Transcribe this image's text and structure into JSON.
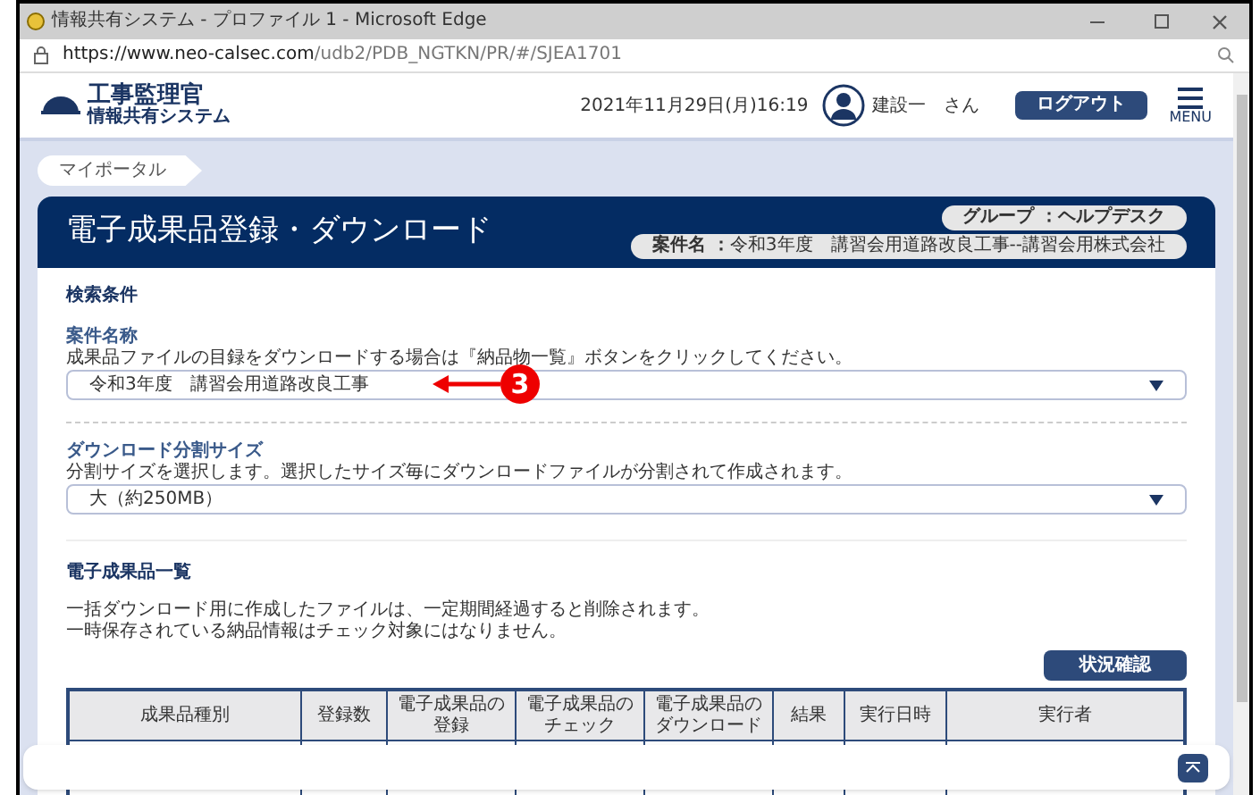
{
  "window": {
    "title": "情報共有システム - プロファイル 1 - Microsoft Edge"
  },
  "address_bar": {
    "url_host": "https://www.neo-calsec.com",
    "url_path": "/udb2/PDB_NGTKN/PR/#/SJEA1701"
  },
  "header": {
    "logo_title": "工事監理官",
    "logo_subtitle": "情報共有システム",
    "datetime": "2021年11月29日(月)16:19",
    "user": "建設一　さん",
    "logout": "ログアウト",
    "menu": "MENU"
  },
  "breadcrumb": "マイポータル",
  "banner": {
    "title": "電子成果品登録・ダウンロード",
    "group": "グループ ：ヘルプデスク",
    "project_label": "案件名 ：",
    "project": "令和3年度　講習会用道路改良工事--講習会用株式会社"
  },
  "search": {
    "heading": "検索条件",
    "fields": [
      {
        "label": "案件名称",
        "hint": "成果品ファイルの目録をダウンロードする場合は『納品物一覧』ボタンをクリックしてください。",
        "value": "令和3年度　講習会用道路改良工事"
      },
      {
        "label": "ダウンロード分割サイズ",
        "hint": "分割サイズを選択します。選択したサイズ毎にダウンロードファイルが分割されて作成されます。",
        "value": "大（約250MB）"
      }
    ]
  },
  "annotation": {
    "label": "3"
  },
  "list": {
    "heading": "電子成果品一覧",
    "notes": [
      "一括ダウンロード用に作成したファイルは、一定期間経過すると削除されます。",
      "一時保存されている納品情報はチェック対象にはなりません。"
    ],
    "status_button": "状況確認",
    "columns": [
      [
        "成果品種別"
      ],
      [
        "登録数"
      ],
      [
        "電子成果品の",
        "登録"
      ],
      [
        "電子成果品の",
        "チェック"
      ],
      [
        "電子成果品の",
        "ダウンロード"
      ],
      [
        "結果"
      ],
      [
        "実行日時"
      ],
      [
        "実行者"
      ]
    ]
  }
}
